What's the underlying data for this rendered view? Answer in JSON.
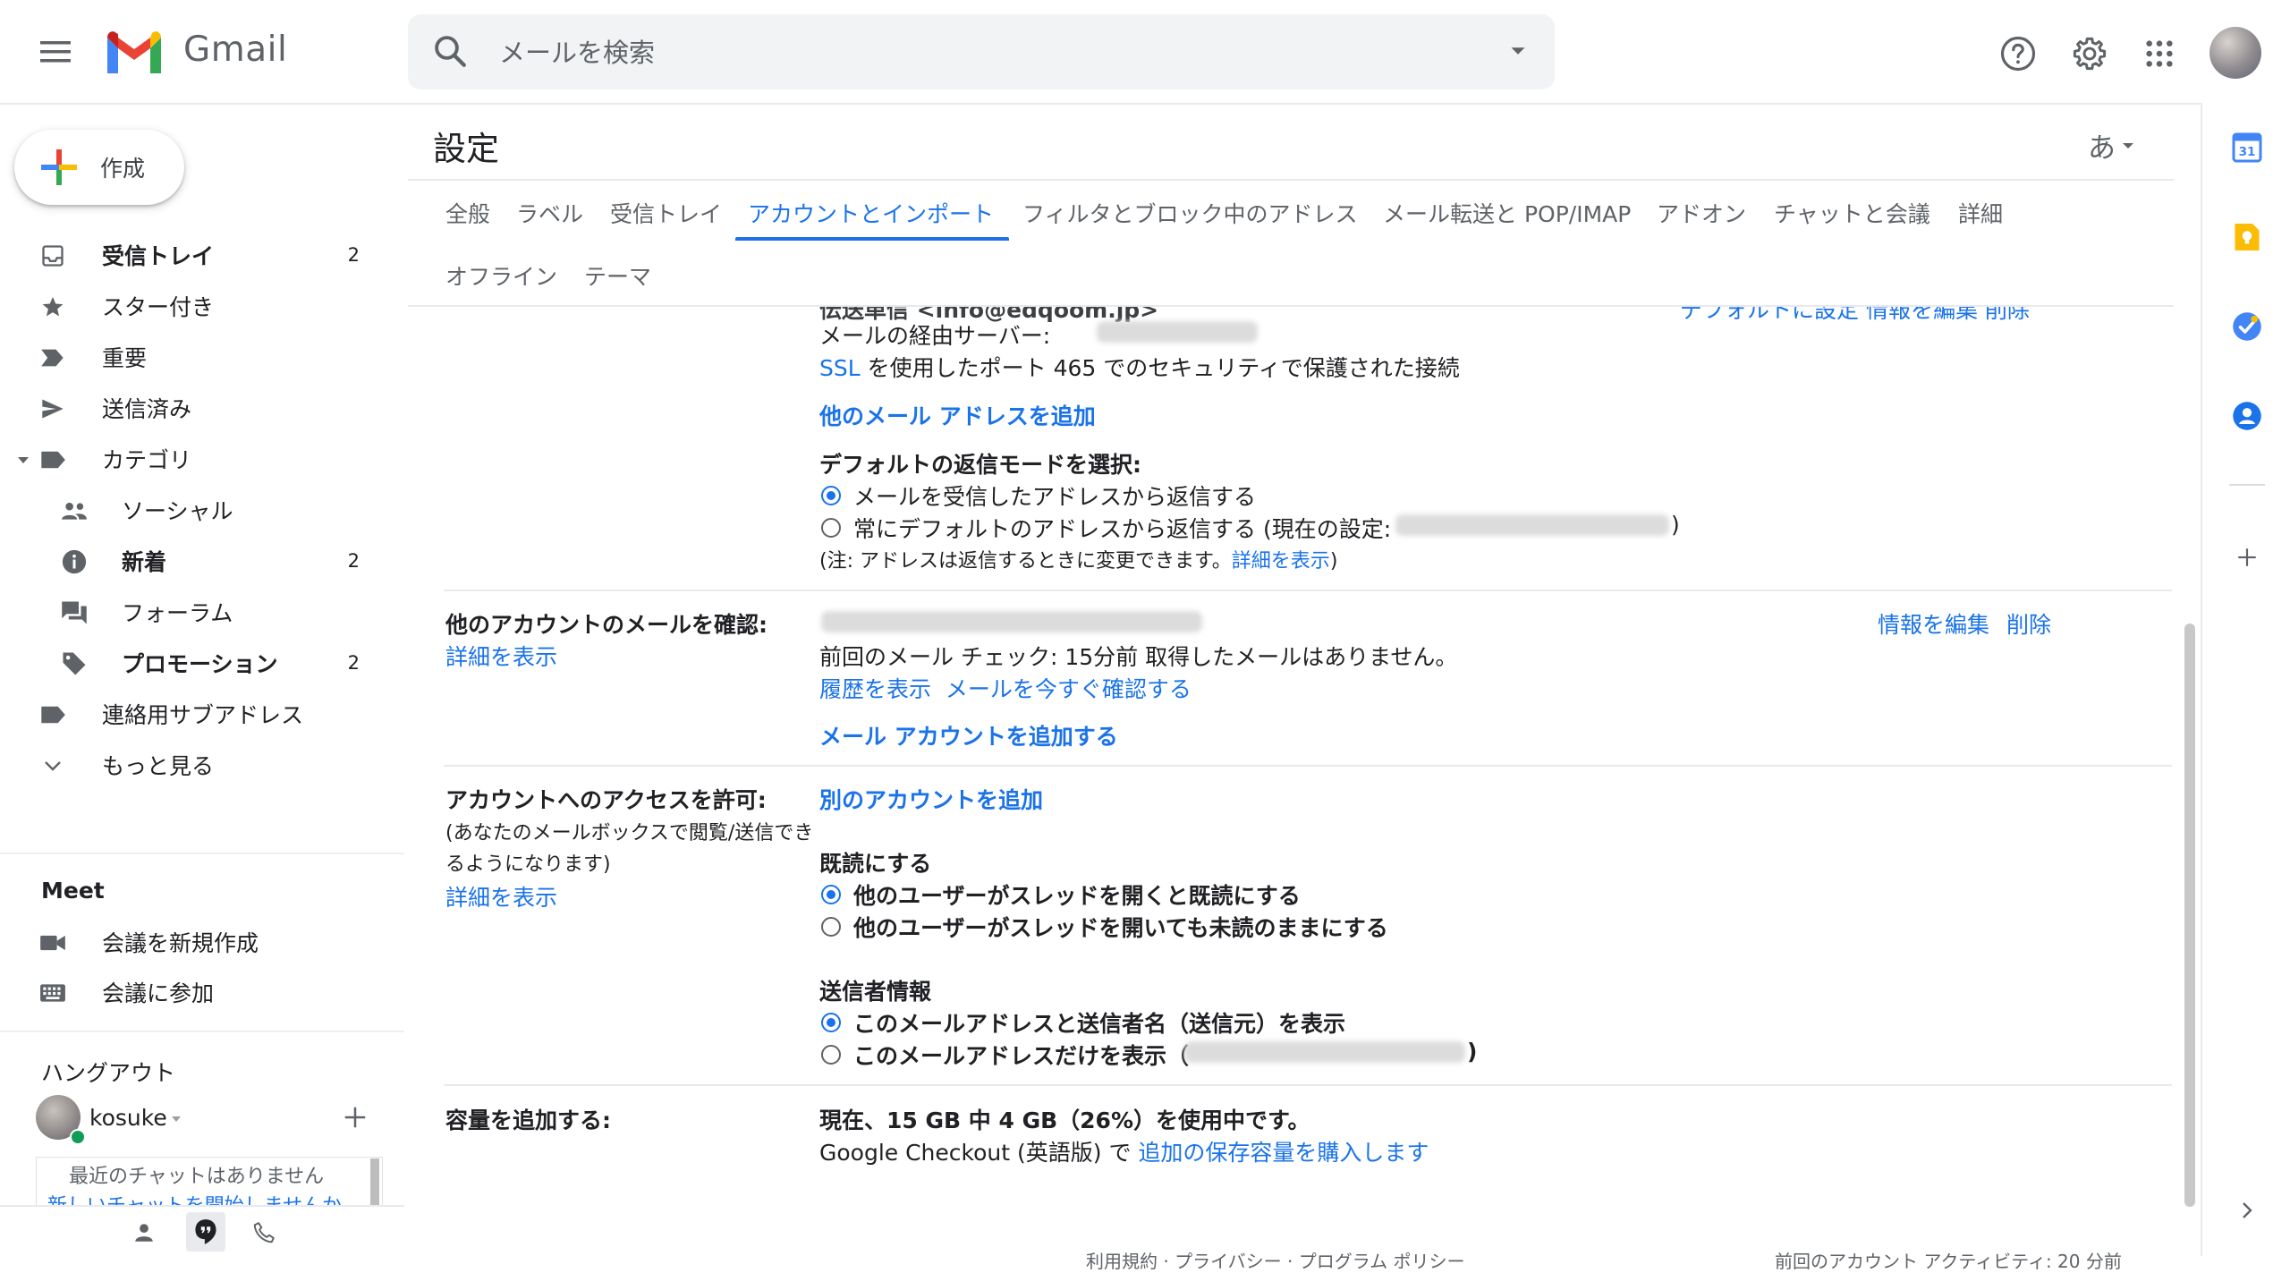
{
  "header": {
    "app_name": "Gmail",
    "search_placeholder": "メールを検索"
  },
  "sidebar": {
    "compose_label": "作成",
    "items": [
      {
        "label": "受信トレイ",
        "count": "2",
        "bold": true
      },
      {
        "label": "スター付き",
        "count": ""
      },
      {
        "label": "重要",
        "count": ""
      },
      {
        "label": "送信済み",
        "count": ""
      },
      {
        "label": "カテゴリ",
        "count": ""
      },
      {
        "label": "ソーシャル",
        "count": ""
      },
      {
        "label": "新着",
        "count": "2",
        "bold": true
      },
      {
        "label": "フォーラム",
        "count": ""
      },
      {
        "label": "プロモーション",
        "count": "2",
        "bold": true
      },
      {
        "label": "連絡用サブアドレス",
        "count": ""
      },
      {
        "label": "もっと見る",
        "count": ""
      }
    ],
    "meet": {
      "title": "Meet",
      "new_meeting": "会議を新規作成",
      "join_meeting": "会議に参加"
    },
    "hangouts": {
      "title": "ハングアウト",
      "user": "kosuke",
      "no_chats": "最近のチャットはありません",
      "start_chat": "新しいチャットを開始しませんか"
    }
  },
  "settings": {
    "title": "設定",
    "input_tools": "あ",
    "tabs": [
      "全般",
      "ラベル",
      "受信トレイ",
      "アカウントとインポート",
      "フィルタとブロック中のアドレス",
      "メール転送と POP/IMAP",
      "アドオン",
      "チャットと会議",
      "詳細",
      "オフライン",
      "テーマ"
    ],
    "active_tab": "アカウントとインポート",
    "send_as": {
      "partial_top": "伝送単信 <info@edqoom.jp>",
      "partial_actions": "デフォルトに設定  情報を編集  削除",
      "server_label": "メールの経由サーバー:",
      "ssl_link": "SSL",
      "ssl_text": "を使用したポート 465 でのセキュリティで保護された接続",
      "add_address": "他のメール アドレスを追加",
      "reply_mode_title": "デフォルトの返信モードを選択:",
      "reply_option_1": "メールを受信したアドレスから返信する",
      "reply_option_2": "常にデフォルトのアドレスから返信する (現在の設定:",
      "reply_option_2_close": ")",
      "reply_note_before": "(注: アドレスは返信するときに変更できます。",
      "reply_note_link": "詳細を表示",
      "reply_note_after": ")"
    },
    "check_mail": {
      "label": "他のアカウントのメールを確認:",
      "learn_more": "詳細を表示",
      "last_check": "前回のメール チェック: 15分前 取得したメールはありません。",
      "history_link": "履歴を表示",
      "check_now_link": "メールを今すぐ確認する",
      "add_account": "メール アカウントを追加する",
      "edit_info": "情報を編集",
      "delete": "削除"
    },
    "grant_access": {
      "label": "アカウントへのアクセスを許可:",
      "desc_line1": "(あなたのメールボックスで閲覧/送信でき",
      "desc_line2": "るようになります)",
      "learn_more": "詳細を表示",
      "add_another": "別のアカウントを追加",
      "mark_read_title": "既読にする",
      "mark_read_option_1": "他のユーザーがスレッドを開くと既読にする",
      "mark_read_option_2": "他のユーザーがスレッドを開いても未読のままにする",
      "sender_info_title": "送信者情報",
      "sender_option_1": "このメールアドレスと送信者名（送信元）を表示",
      "sender_option_2": "このメールアドレスだけを表示（",
      "sender_option_2_close": ")"
    },
    "storage": {
      "label": "容量を追加する:",
      "usage": "現在、15 GB 中 4 GB（26%）を使用中です。",
      "checkout_text": "Google Checkout (英語版) で",
      "buy_link": "追加の保存容量を購入します"
    }
  },
  "footer": {
    "left": "利用規約 · プライバシー · プログラム ポリシー",
    "right": "前回のアカウント アクティビティ: 20 分前"
  },
  "colors": {
    "accent": "#1a73e8",
    "text": "#202124",
    "muted": "#5f6368"
  }
}
